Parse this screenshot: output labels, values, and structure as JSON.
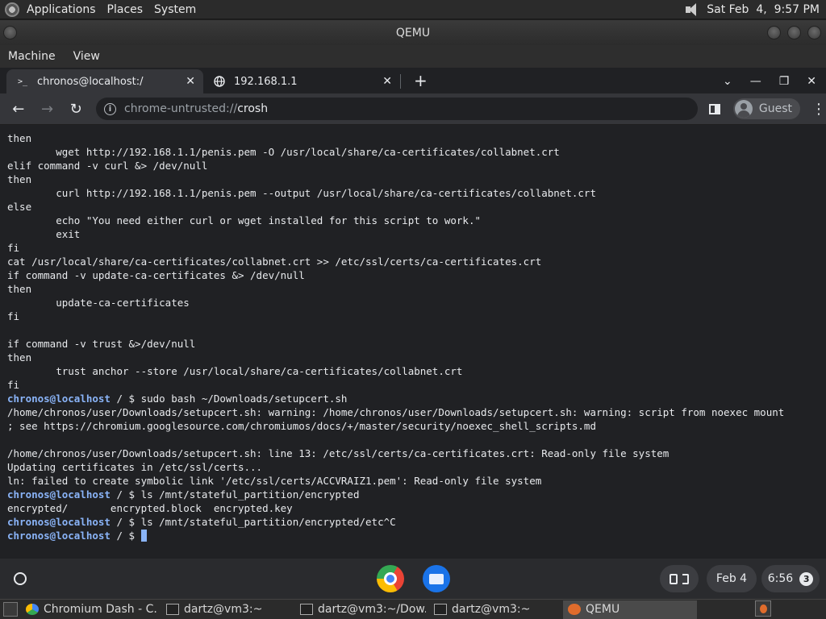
{
  "top_panel": {
    "menus": [
      "Applications",
      "Places",
      "System"
    ],
    "clock": "Sat Feb  4,  9:57 PM"
  },
  "qemu": {
    "title": "QEMU",
    "menus": [
      "Machine",
      "View"
    ]
  },
  "chrome": {
    "tabs": [
      {
        "title": "chronos@localhost:/",
        "favicon": ">_",
        "active": true
      },
      {
        "title": "192.168.1.1",
        "favicon": "globe-icon",
        "active": false
      }
    ],
    "omnibox": {
      "scheme": "chrome-untrusted://",
      "host": "crosh"
    },
    "profile_label": "Guest"
  },
  "terminal": {
    "lines": [
      {
        "text": "then"
      },
      {
        "text": "        wget http://192.168.1.1/penis.pem -O /usr/local/share/ca-certificates/collabnet.crt"
      },
      {
        "text": "elif command -v curl &> /dev/null"
      },
      {
        "text": "then"
      },
      {
        "text": "        curl http://192.168.1.1/penis.pem --output /usr/local/share/ca-certificates/collabnet.crt"
      },
      {
        "text": "else"
      },
      {
        "text": "        echo \"You need either curl or wget installed for this script to work.\""
      },
      {
        "text": "        exit"
      },
      {
        "text": "fi"
      },
      {
        "text": "cat /usr/local/share/ca-certificates/collabnet.crt >> /etc/ssl/certs/ca-certificates.crt"
      },
      {
        "text": "if command -v update-ca-certificates &> /dev/null"
      },
      {
        "text": "then"
      },
      {
        "text": "        update-ca-certificates"
      },
      {
        "text": "fi"
      },
      {
        "text": ""
      },
      {
        "text": "if command -v trust &>/dev/null"
      },
      {
        "text": "then"
      },
      {
        "text": "        trust anchor --store /usr/local/share/ca-certificates/collabnet.crt"
      },
      {
        "text": "fi"
      },
      {
        "prompt": "chronos@localhost",
        "text": " / $ sudo bash ~/Downloads/setupcert.sh"
      },
      {
        "text": "/home/chronos/user/Downloads/setupcert.sh: warning: /home/chronos/user/Downloads/setupcert.sh: warning: script from noexec mount"
      },
      {
        "text": "; see https://chromium.googlesource.com/chromiumos/docs/+/master/security/noexec_shell_scripts.md"
      },
      {
        "text": ""
      },
      {
        "text": "/home/chronos/user/Downloads/setupcert.sh: line 13: /etc/ssl/certs/ca-certificates.crt: Read-only file system"
      },
      {
        "text": "Updating certificates in /etc/ssl/certs..."
      },
      {
        "text": "ln: failed to create symbolic link '/etc/ssl/certs/ACCVRAIZ1.pem': Read-only file system"
      },
      {
        "prompt": "chronos@localhost",
        "text": " / $ ls /mnt/stateful_partition/encrypted"
      },
      {
        "text": "encrypted/       encrypted.block  encrypted.key"
      },
      {
        "prompt": "chronos@localhost",
        "text": " / $ ls /mnt/stateful_partition/encrypted/etc^C"
      },
      {
        "prompt": "chronos@localhost",
        "text": " / $ ",
        "cursor": true
      }
    ]
  },
  "shelf": {
    "date": "Feb 4",
    "time": "6:56",
    "notification_count": "3"
  },
  "host_taskbar": {
    "tasks": [
      {
        "label": "Chromium Dash - C...",
        "icon": "chromium-icon"
      },
      {
        "label": "dartz@vm3:~",
        "icon": "terminal-icon"
      },
      {
        "label": "dartz@vm3:~/Dow...",
        "icon": "terminal-icon"
      },
      {
        "label": "dartz@vm3:~",
        "icon": "terminal-icon"
      },
      {
        "label": "QEMU",
        "icon": "qemu-icon",
        "active": true
      }
    ]
  },
  "colors": {
    "prompt": "#8ab4f8",
    "terminal_bg": "#202124",
    "terminal_fg": "#e8eaed"
  }
}
